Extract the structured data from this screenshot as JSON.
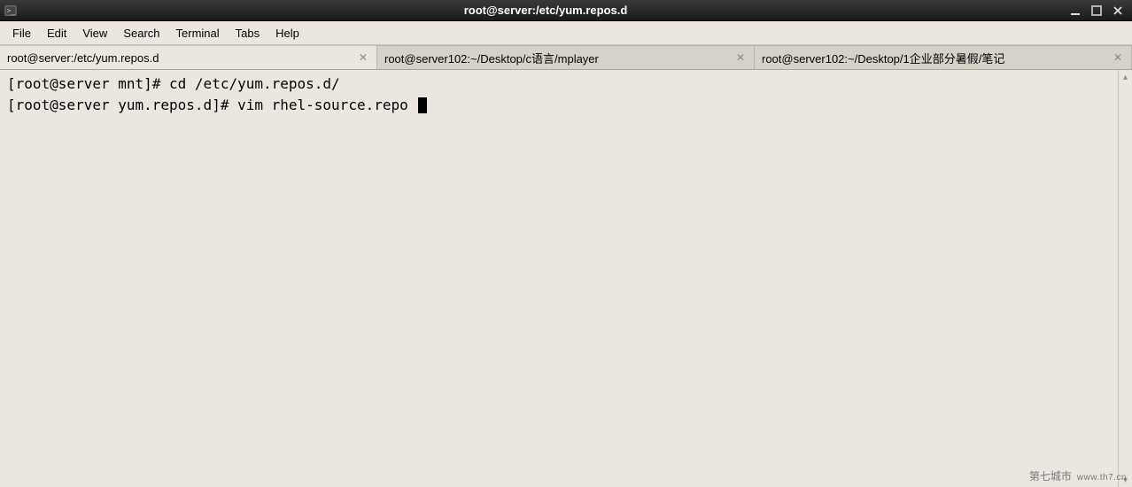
{
  "titlebar": {
    "title": "root@server:/etc/yum.repos.d"
  },
  "menubar": {
    "items": [
      "File",
      "Edit",
      "View",
      "Search",
      "Terminal",
      "Tabs",
      "Help"
    ]
  },
  "tabs": [
    {
      "label": "root@server:/etc/yum.repos.d",
      "active": true
    },
    {
      "label": "root@server102:~/Desktop/c语言/mplayer",
      "active": false
    },
    {
      "label": "root@server102:~/Desktop/1企业部分暑假/笔记",
      "active": false
    }
  ],
  "terminal": {
    "lines": [
      "[root@server mnt]# cd /etc/yum.repos.d/",
      "[root@server yum.repos.d]# vim rhel-source.repo "
    ]
  },
  "watermark": {
    "text1": "第七城市",
    "text2": "www.th7.cn"
  }
}
